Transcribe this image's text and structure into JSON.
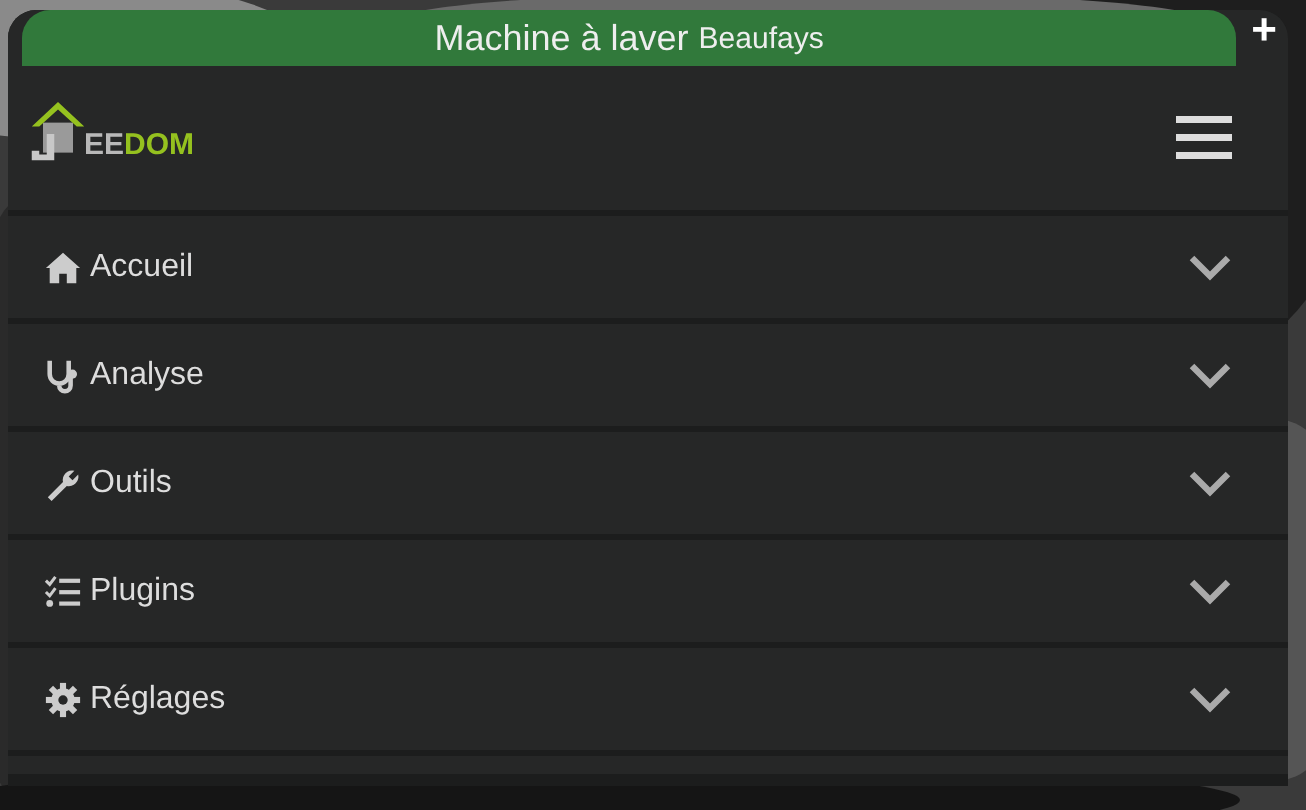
{
  "header": {
    "title": "Machine à laver",
    "subtitle": "Beaufays",
    "add_symbol": "+"
  },
  "logo": {
    "parts": [
      "EE",
      "DOM"
    ]
  },
  "menu": [
    {
      "label": "Accueil",
      "expanded": false
    },
    {
      "label": "Analyse",
      "expanded": false
    },
    {
      "label": "Outils",
      "expanded": false
    },
    {
      "label": "Plugins",
      "expanded": false
    },
    {
      "label": "Réglages",
      "expanded": false
    }
  ]
}
